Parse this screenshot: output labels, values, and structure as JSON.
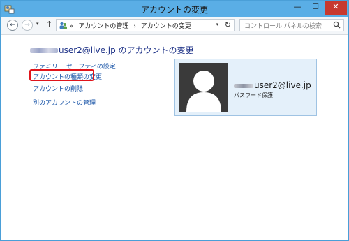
{
  "window": {
    "title": "アカウントの変更",
    "controls": {
      "minimize": "—",
      "maximize": "☐",
      "close": "✕"
    }
  },
  "toolbar": {
    "back": "←",
    "forward": "→",
    "dropdown": "▾",
    "up": "↑",
    "breadcrumb": {
      "overflow": "«",
      "items": [
        "アカウントの管理",
        "›",
        "アカウントの変更"
      ]
    },
    "address_dropdown": "▾",
    "refresh": "↻",
    "search_placeholder": "コントロール パネルの検索"
  },
  "main": {
    "heading_suffix": "user2@live.jp のアカウントの変更",
    "links": [
      {
        "label": "ファミリー セーフティの設定"
      },
      {
        "label": "アカウントの種類の変更"
      },
      {
        "label": "アカウントの削除"
      },
      {
        "label": "別のアカウントの管理"
      }
    ],
    "highlighted_link": "アカウントの種類の変更"
  },
  "account_card": {
    "name_suffix": "user2@live.jp",
    "status": "パスワード保護"
  },
  "colors": {
    "titlebar": "#5aaee6",
    "link": "#1a55a8",
    "heading": "#1e3287",
    "highlight": "#e0151c",
    "card_bg": "#e4f0fa",
    "close_button": "#c7392f"
  }
}
